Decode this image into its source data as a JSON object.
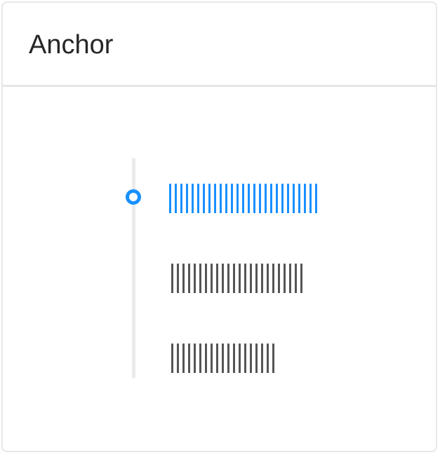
{
  "card": {
    "title": "Anchor"
  },
  "anchor": {
    "active_index": 0,
    "links": [
      {
        "bar_count": 27,
        "active": true
      },
      {
        "bar_count": 24,
        "active": false
      },
      {
        "bar_count": 19,
        "active": false
      }
    ]
  },
  "colors": {
    "accent": "#1890ff",
    "link_text": "#555555",
    "rail": "#ebebeb",
    "title": "#262626"
  }
}
